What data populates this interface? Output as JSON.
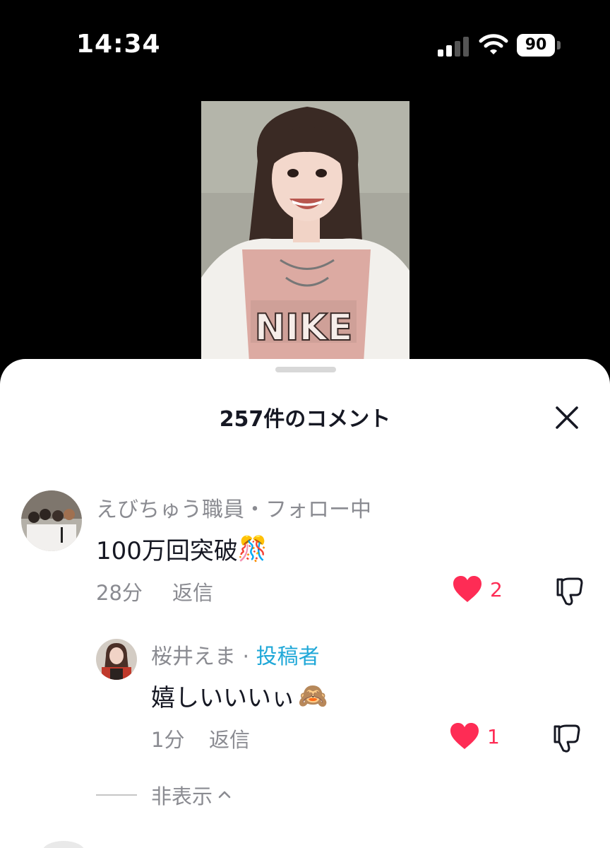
{
  "status": {
    "time": "14:34",
    "battery": "90"
  },
  "sheet": {
    "title": "257件のコメント",
    "close_icon": "close-x-icon"
  },
  "comments": [
    {
      "username": "えびちゅう職員・フォロー中",
      "text": "100万回突破",
      "emoji": "🎊",
      "time": "28分",
      "reply_label": "返信",
      "likes": "2",
      "liked": true
    }
  ],
  "replies": [
    {
      "username": "桜井えま · ",
      "creator_tag": "投稿者",
      "text": "嬉しいいいぃ",
      "emoji": "🙈",
      "time": "1分",
      "reply_label": "返信",
      "likes": "1",
      "liked": true
    }
  ],
  "hide_replies": {
    "label": "非表示",
    "icon": "chevron-up-icon"
  },
  "colors": {
    "like": "#fe2c55",
    "creator": "#20a8d8",
    "secondary_text": "#8a8b91"
  }
}
